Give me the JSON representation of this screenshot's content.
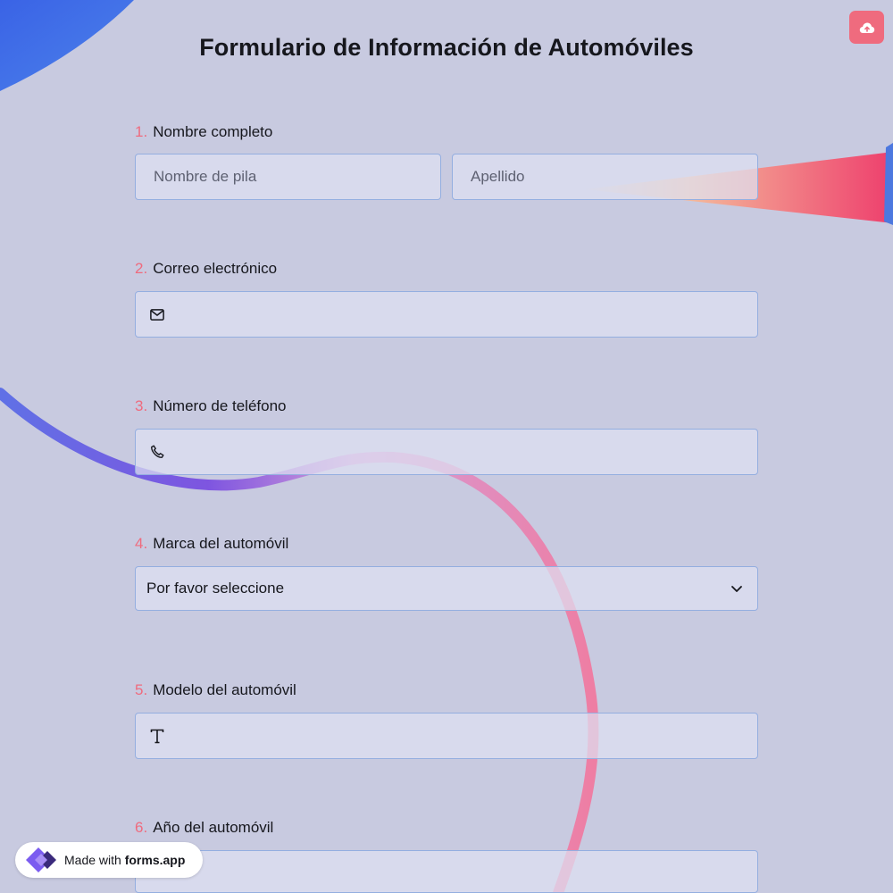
{
  "form": {
    "title": "Formulario de Información de Automóviles",
    "questions": [
      {
        "number": "1.",
        "label": "Nombre completo",
        "first_placeholder": "Nombre de pila",
        "last_placeholder": "Apellido"
      },
      {
        "number": "2.",
        "label": "Correo electrónico",
        "icon": "envelope-icon",
        "value": ""
      },
      {
        "number": "3.",
        "label": "Número de teléfono",
        "icon": "phone-icon",
        "value": ""
      },
      {
        "number": "4.",
        "label": "Marca del automóvil",
        "selected": "Por favor seleccione",
        "icon": "chevron-down-icon"
      },
      {
        "number": "5.",
        "label": "Modelo del automóvil",
        "icon": "text-icon",
        "value": ""
      },
      {
        "number": "6.",
        "label": "Año del automóvil"
      }
    ]
  },
  "toolbar": {
    "upload_icon": "cloud-upload-icon"
  },
  "badge": {
    "prefix": "Made with",
    "brand": "forms.app"
  },
  "colors": {
    "accent": "#ef6b7e",
    "background": "#c8cae0",
    "field_border": "#94aee0"
  }
}
